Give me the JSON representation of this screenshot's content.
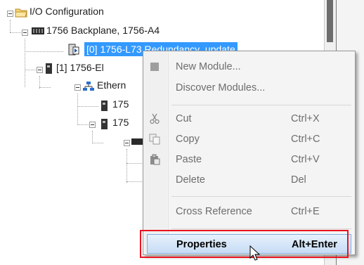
{
  "tree": {
    "io_configuration": "I/O Configuration",
    "backplane": "1756 Backplane, 1756-A4",
    "module0": "[0] 1756-L73 Redundancy_update",
    "module1": "[1] 1756-El",
    "ethernet": "Ethern",
    "device1": "175",
    "device2": "175"
  },
  "context_menu": {
    "items": [
      {
        "label": "New Module...",
        "shortcut": "",
        "icon": "new-module-icon"
      },
      {
        "label": "Discover Modules...",
        "shortcut": ""
      },
      {
        "label": "Cut",
        "shortcut": "Ctrl+X",
        "icon": "scissors-icon"
      },
      {
        "label": "Copy",
        "shortcut": "Ctrl+C",
        "icon": "copy-icon"
      },
      {
        "label": "Paste",
        "shortcut": "Ctrl+V",
        "icon": "paste-icon"
      },
      {
        "label": "Delete",
        "shortcut": "Del"
      },
      {
        "label": "Cross Reference",
        "shortcut": "Ctrl+E"
      },
      {
        "label": "Properties",
        "shortcut": "Alt+Enter"
      }
    ]
  },
  "colors": {
    "selection": "#3399ff",
    "highlight_border": "#84acdd",
    "annotation_box": "#e8141d"
  }
}
